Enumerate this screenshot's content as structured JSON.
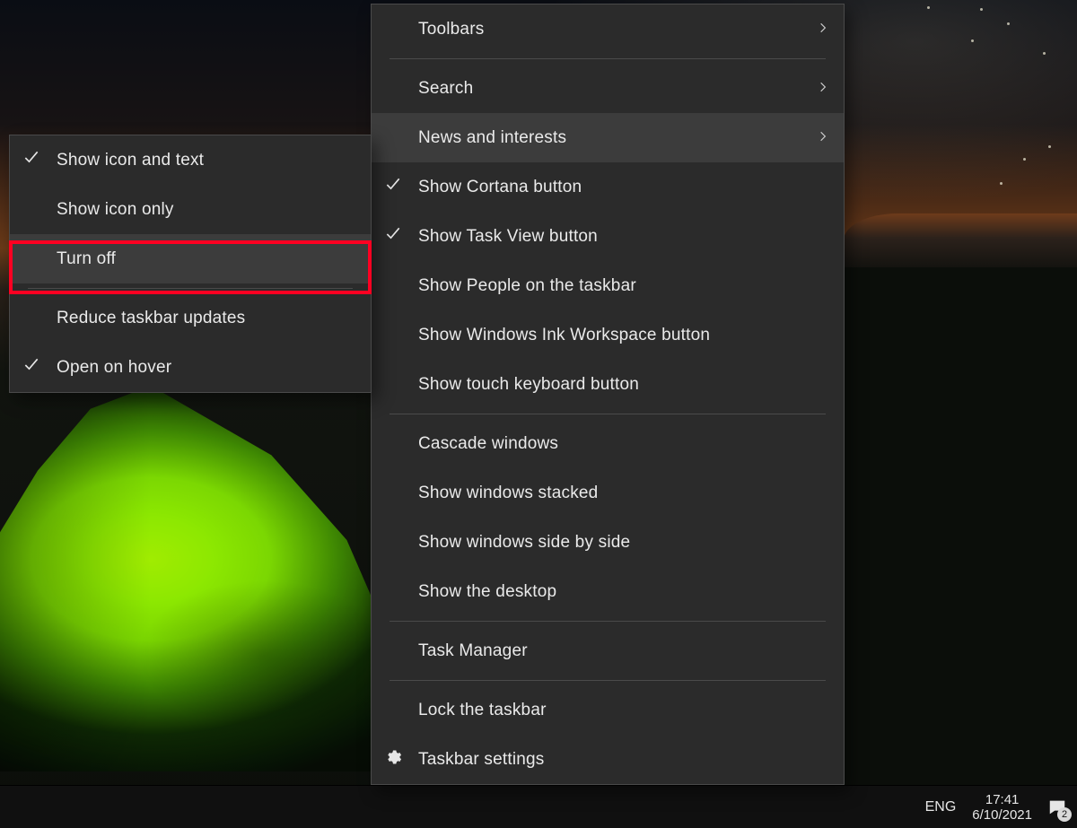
{
  "mainMenu": {
    "items": [
      {
        "label": "Toolbars",
        "arrow": true
      },
      {
        "label": "Search",
        "arrow": true
      },
      {
        "label": "News and interests",
        "arrow": true,
        "hovered": true
      },
      {
        "label": "Show Cortana button",
        "checked": true
      },
      {
        "label": "Show Task View button",
        "checked": true
      },
      {
        "label": "Show People on the taskbar"
      },
      {
        "label": "Show Windows Ink Workspace button"
      },
      {
        "label": "Show touch keyboard button"
      },
      {
        "label": "Cascade windows"
      },
      {
        "label": "Show windows stacked"
      },
      {
        "label": "Show windows side by side"
      },
      {
        "label": "Show the desktop"
      },
      {
        "label": "Task Manager"
      },
      {
        "label": "Lock the taskbar"
      },
      {
        "label": "Taskbar settings",
        "gear": true
      }
    ]
  },
  "subMenu": {
    "items": [
      {
        "label": "Show icon and text",
        "checked": true
      },
      {
        "label": "Show icon only"
      },
      {
        "label": "Turn off",
        "hovered": true,
        "redHighlight": true
      },
      {
        "label": "Reduce taskbar updates"
      },
      {
        "label": "Open on hover",
        "checked": true
      }
    ]
  },
  "taskbar": {
    "language": "ENG",
    "time": "17:41",
    "date": "6/10/2021",
    "notificationsCount": "2"
  }
}
